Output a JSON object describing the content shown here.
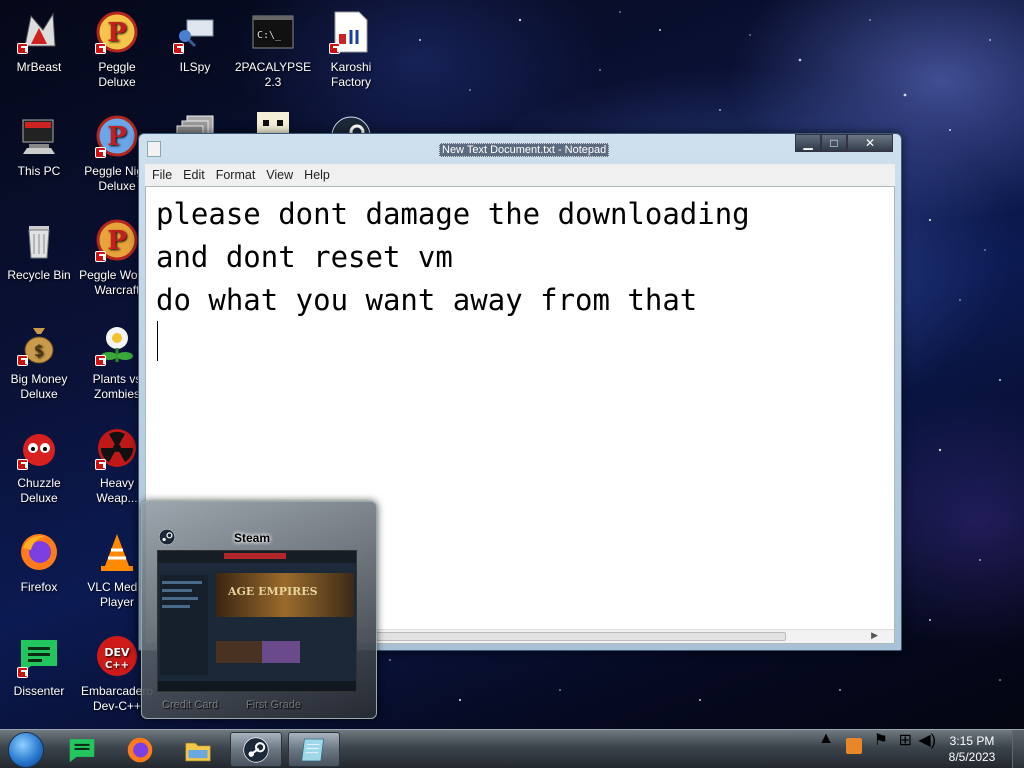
{
  "desktop_icons": [
    {
      "label": "MrBeast",
      "icon": "mrbeast-icon"
    },
    {
      "label": "Peggle Deluxe",
      "icon": "peggle-icon"
    },
    {
      "label": "ILSpy",
      "icon": "ilspy-icon"
    },
    {
      "label": "2PACALYPSE 2.3",
      "icon": "terminal-icon"
    },
    {
      "label": "Karoshi Factory",
      "icon": "karoshi-icon"
    },
    {
      "label": "This PC",
      "icon": "computer-icon"
    },
    {
      "label": "Peggle Nigh Deluxe",
      "icon": "peggle-icon"
    },
    {
      "label": "Recycle Bin",
      "icon": "recycle-bin-icon"
    },
    {
      "label": "Peggle Wor of Warcraft",
      "icon": "peggle-icon"
    },
    {
      "label": "Big Money Deluxe",
      "icon": "money-bag-icon"
    },
    {
      "label": "Plants vs Zombies",
      "icon": "plant-icon"
    },
    {
      "label": "Chuzzle Deluxe",
      "icon": "chuzzle-icon"
    },
    {
      "label": "Heavy Weap...",
      "icon": "radiation-icon"
    },
    {
      "label": "Firefox",
      "icon": "firefox-icon"
    },
    {
      "label": "VLC Media Player",
      "icon": "vlc-cone-icon"
    },
    {
      "label": "Dissenter",
      "icon": "dissenter-icon"
    },
    {
      "label": "Embarcadero Dev-C++",
      "icon": "devcpp-icon"
    }
  ],
  "notepad": {
    "title": "New Text Document.txt - Notepad",
    "menu": [
      "File",
      "Edit",
      "Format",
      "View",
      "Help"
    ],
    "content": "please dont damage the downloading\nand dont reset vm\ndo what you want away from that",
    "buttons": {
      "minimize": "▁",
      "maximize": "□",
      "close": "✕"
    }
  },
  "taskbar_preview": {
    "title": "Steam",
    "banner_text": "AGE EMPIRES",
    "ghost_labels": [
      "Credit Card",
      "First Grade"
    ]
  },
  "taskbar": {
    "items": [
      "dissenter",
      "firefox",
      "file-explorer",
      "steam",
      "notepad"
    ],
    "clock_time": "3:15 PM",
    "clock_date": "8/5/2023"
  }
}
